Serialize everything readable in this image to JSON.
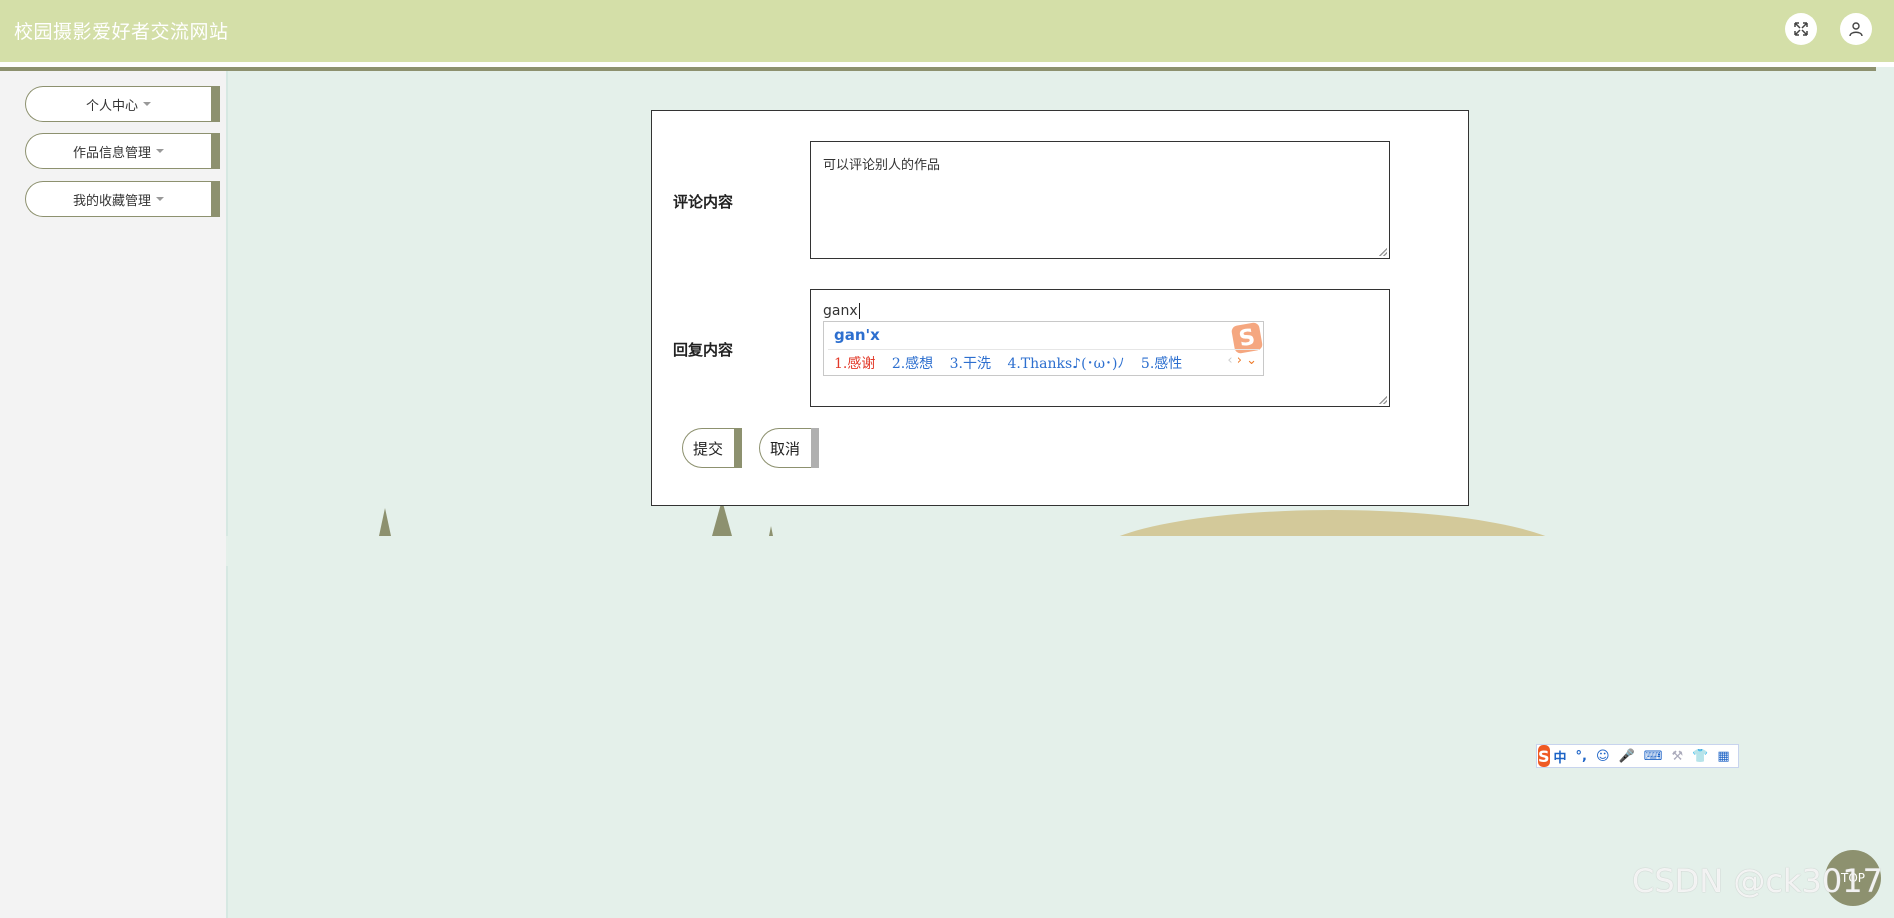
{
  "header": {
    "site_title": "校园摄影爱好者交流网站",
    "fullscreen_icon": "expand-icon",
    "user_icon": "user-icon"
  },
  "sidebar": {
    "items": [
      {
        "label": "个人中心"
      },
      {
        "label": "作品信息管理"
      },
      {
        "label": "我的收藏管理"
      }
    ]
  },
  "form": {
    "comment_label": "评论内容",
    "comment_value": "可以评论别人的作品",
    "reply_label": "回复内容",
    "reply_value": "ganx",
    "submit_label": "提交",
    "cancel_label": "取消"
  },
  "ime": {
    "composition": "gan'x",
    "candidates": [
      "1.感谢",
      "2.感想",
      "3.干洗",
      "4.Thanks♪(･ω･)ﾉ",
      "5.感性"
    ],
    "logo": "S",
    "toolbar": {
      "logo": "S",
      "mode": "中",
      "punct": "°,",
      "icons": [
        "emoji-icon",
        "microphone-icon",
        "keyboard-icon",
        "tools-icon",
        "skin-icon",
        "grid-icon"
      ]
    }
  },
  "top_button": {
    "label": "TOP"
  },
  "watermark": "CSDN @ck3017",
  "colors": {
    "header_bg": "#d4dfa8",
    "accent_olive": "#8d916f",
    "page_bg": "#e4f0ea",
    "sidebar_bg": "#f3f3f3"
  }
}
